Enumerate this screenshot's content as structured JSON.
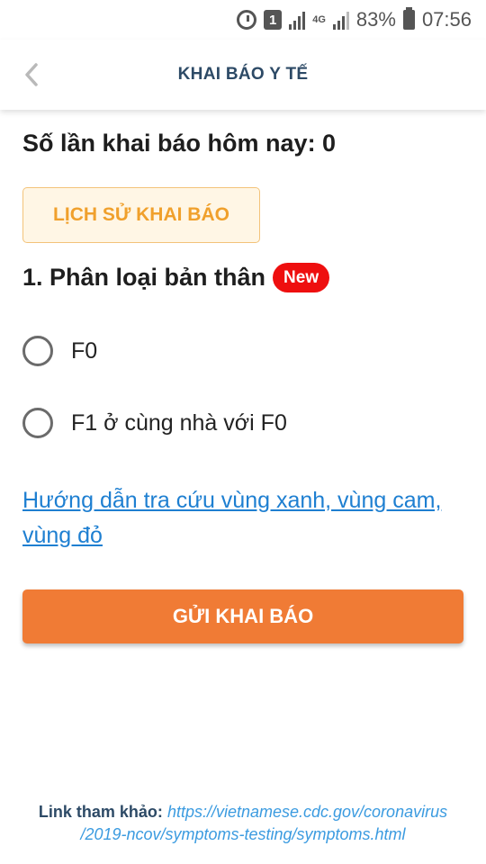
{
  "status_bar": {
    "badge": "1",
    "network": "4G",
    "battery": "83%",
    "time": "07:56"
  },
  "header": {
    "title": "KHAI BÁO Y TẾ",
    "back_icon": "chevron-left-icon"
  },
  "main": {
    "count_label": "Số lần khai báo hôm nay: 0",
    "history_button": "LỊCH SỬ KHAI BÁO",
    "section_title": "1. Phân loại bản thân",
    "new_badge": "New",
    "options": [
      {
        "label": "F0",
        "selected": false
      },
      {
        "label": "F1 ở cùng nhà với F0",
        "selected": false
      }
    ],
    "guide_link": "Hướng dẫn tra cứu vùng xanh, vùng cam, vùng đỏ",
    "submit_button": "GỬI KHAI BÁO"
  },
  "footer": {
    "label": "Link tham khảo:",
    "link_line1": "https://vietnamese.cdc.gov/coronavirus",
    "link_line2": "/2019-ncov/symptoms-testing/symptoms.html"
  },
  "colors": {
    "accent": "#f07b35",
    "history_text": "#f0a02c",
    "title": "#2d4a66",
    "link": "#1e7fd1",
    "badge": "#ee0f0f"
  }
}
